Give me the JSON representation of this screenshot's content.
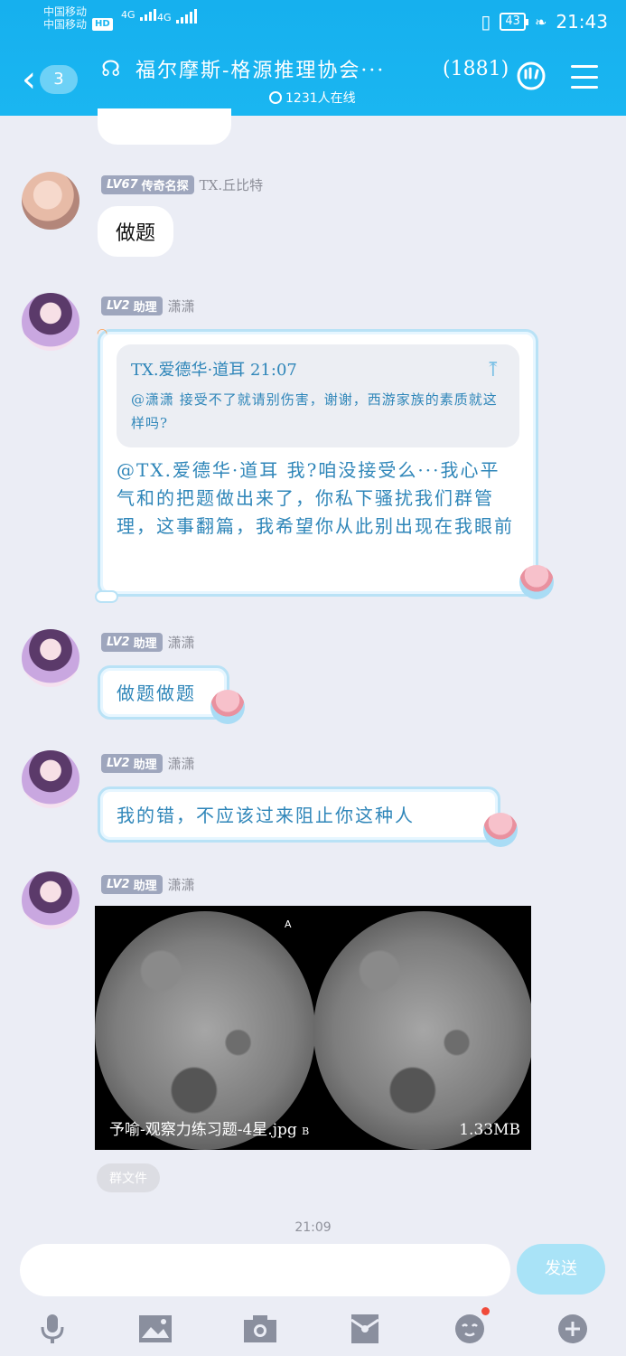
{
  "status_bar": {
    "carrier1": "中国移动",
    "carrier2": "中国移动",
    "hd": "HD",
    "net1": "4G",
    "net2": "4G",
    "battery": "43",
    "time": "21:43"
  },
  "header": {
    "back_count": "3",
    "title": "福尔摩斯-格源推理协会···",
    "member_count": "(1881)",
    "online": "1231人在线"
  },
  "messages": [
    {
      "level": "LV67",
      "rank": "传奇名探",
      "sender": "TX.丘比特",
      "text": "做题"
    },
    {
      "level": "LV2",
      "rank": "助理",
      "sender": "潇潇",
      "quote_header": "TX.爱德华·道耳  21:07",
      "quote_text": "@潇潇 接受不了就请别伤害，谢谢，西游家族的素质就这样吗?",
      "text": "@TX.爱德华·道耳 我?咱没接受么···我心平气和的把题做出来了，你私下骚扰我们群管理，这事翻篇，我希望你从此别出现在我眼前"
    },
    {
      "level": "LV2",
      "rank": "助理",
      "sender": "潇潇",
      "text": "做题做题"
    },
    {
      "level": "LV2",
      "rank": "助理",
      "sender": "潇潇",
      "text": "我的错，不应该过来阻止你这种人"
    },
    {
      "level": "LV2",
      "rank": "助理",
      "sender": "潇潇",
      "image_label_a": "A",
      "image_caption": "予喻-观察力练习题-4星.jpg",
      "image_label_b": "B",
      "image_size": "1.33MB"
    }
  ],
  "file_tag": "群文件",
  "timestamp": "21:09",
  "input": {
    "placeholder": "",
    "send_label": "发送"
  },
  "icons": {
    "toolbar": [
      "mic-icon",
      "image-icon",
      "camera-icon",
      "red-packet-icon",
      "emoji-icon",
      "plus-icon"
    ]
  },
  "colors": {
    "header": "#1ab6f1",
    "bubble_text": "#2f86b9",
    "send_button": "#a9e3f7",
    "notification_dot": "#f04a3a"
  }
}
